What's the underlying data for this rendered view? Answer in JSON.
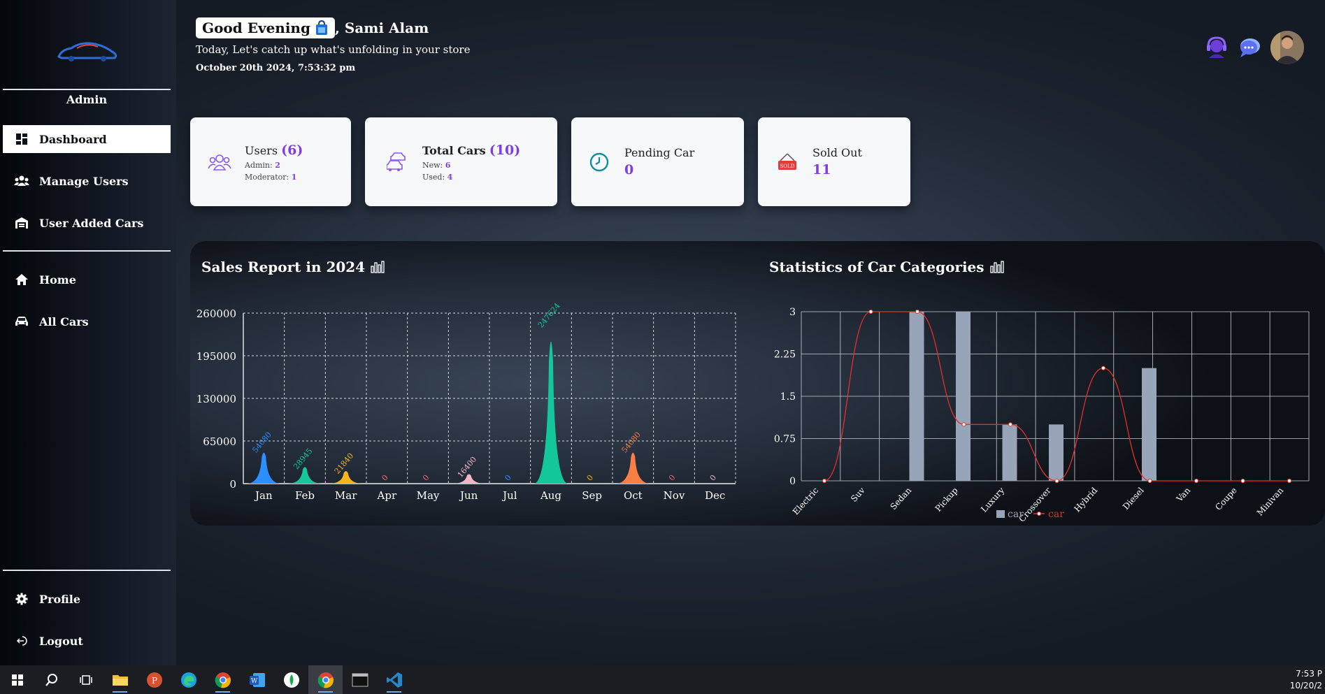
{
  "sidebar": {
    "role": "Admin",
    "items": [
      {
        "label": "Dashboard",
        "icon": "dashboard-icon",
        "active": true
      },
      {
        "label": "Manage Users",
        "icon": "users-icon"
      },
      {
        "label": "User Added Cars",
        "icon": "garage-icon"
      },
      {
        "label": "Home",
        "icon": "home-icon"
      },
      {
        "label": "All Cars",
        "icon": "car-icon"
      }
    ],
    "bottom": [
      {
        "label": "Profile",
        "icon": "gear-icon"
      },
      {
        "label": "Logout",
        "icon": "logout-icon"
      }
    ]
  },
  "header": {
    "greeting": "Good Evening",
    "name": ", Sami Alam",
    "subtitle": "Today, Let's catch up what's unfolding in your store",
    "datetime": "October 20th 2024, 7:53:32 pm"
  },
  "cards": {
    "users": {
      "title": "Users",
      "count": "(6)",
      "line1_label": "Admin: ",
      "line1_value": "2",
      "line2_label": "Moderator: ",
      "line2_value": "1"
    },
    "cars": {
      "title": "Total Cars",
      "count": "(10)",
      "line1_label": "New: ",
      "line1_value": "6",
      "line2_label": "Used: ",
      "line2_value": "4"
    },
    "pending": {
      "title": "Pending Car",
      "value": "0"
    },
    "sold": {
      "title": "Sold Out",
      "value": "11",
      "badge": "SOLD"
    }
  },
  "panels": {
    "sales_title": "Sales Report in 2024",
    "stats_title": "Statistics of Car Categories"
  },
  "chart_data": [
    {
      "type": "area",
      "title": "Sales Report in 2024",
      "categories": [
        "Jan",
        "Feb",
        "Mar",
        "Apr",
        "May",
        "Jun",
        "Jul",
        "Aug",
        "Sep",
        "Oct",
        "Nov",
        "Dec"
      ],
      "values": [
        54080,
        28945,
        21840,
        0,
        0,
        16400,
        0,
        247624,
        0,
        54080,
        0,
        0
      ],
      "ylim": [
        0,
        260000
      ],
      "yticks": [
        "260000",
        "195000",
        "130000",
        "65000",
        "0"
      ],
      "colors": [
        "#2b8fff",
        "#14c79a",
        "#f6b31b",
        "#f36b6b",
        "#f36b6b",
        "#f4b6c6",
        "#2b8fff",
        "#14c79a",
        "#f6b31b",
        "#fb7e45",
        "#f36b6b",
        "#f4b6c6"
      ],
      "grid": true
    },
    {
      "type": "bar",
      "title": "Statistics of Car Categories",
      "categories": [
        "Electric",
        "Suv",
        "Sedan",
        "Pickup",
        "Luxury",
        "Crossover",
        "Hybrid",
        "Diesel",
        "Van",
        "Coupe",
        "Minivan"
      ],
      "series": [
        {
          "name": "car",
          "type": "bar",
          "values": [
            0,
            3,
            3,
            1,
            1,
            0,
            2,
            0,
            0,
            0,
            0
          ],
          "color": "#98a4b8"
        },
        {
          "name": "car",
          "type": "line",
          "values": [
            0,
            3,
            3,
            1,
            1,
            0,
            2,
            0,
            0,
            0,
            0
          ],
          "color": "#e0312b"
        }
      ],
      "ylim": [
        0,
        3
      ],
      "yticks": [
        "3",
        "2.25",
        "1.5",
        "0.75",
        "0"
      ],
      "grid": true,
      "legend": "bottom"
    }
  ],
  "taskbar": {
    "time": "7:53 P",
    "date": "10/20/2"
  }
}
